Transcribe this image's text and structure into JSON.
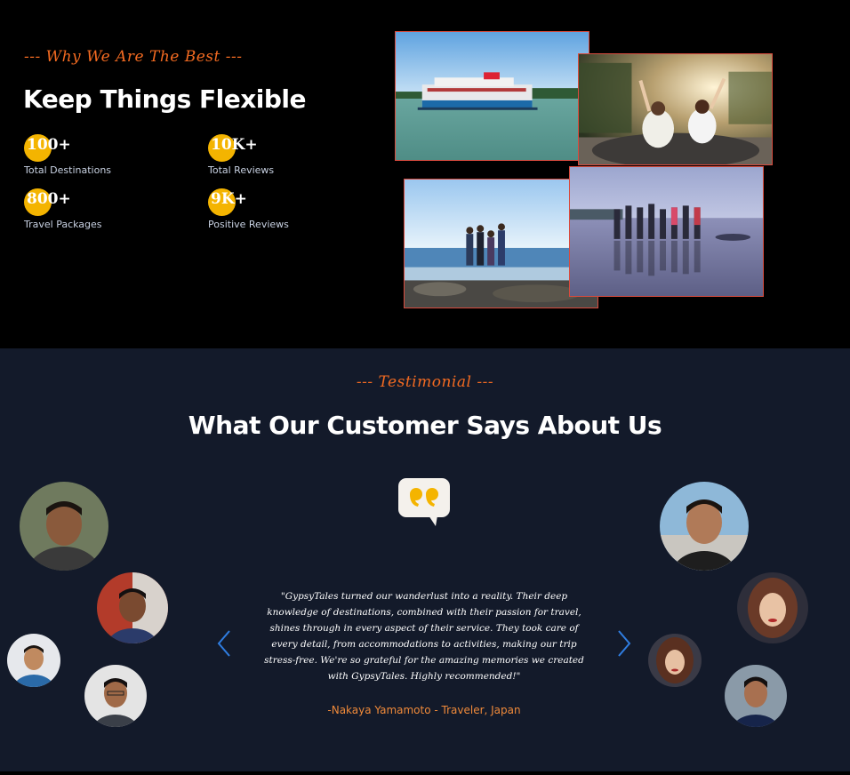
{
  "why": {
    "eyebrow": "--- Why We Are The Best ---",
    "title": "Keep Things Flexible",
    "stats": [
      {
        "value": "100+",
        "label": "Total Destinations"
      },
      {
        "value": "10K+",
        "label": "Total Reviews"
      },
      {
        "value": "800+",
        "label": "Travel Packages"
      },
      {
        "value": "9K+",
        "label": "Positive Reviews"
      }
    ]
  },
  "testimonial": {
    "eyebrow": "--- Testimonial ---",
    "title": "What Our Customer Says About Us",
    "quote": "\"GypsyTales turned our wanderlust into a reality. Their deep knowledge of destinations, combined with their passion for travel, shines through in every aspect of their service. They took care of every detail, from accommodations to activities, making our trip stress-free. We're so grateful for the amazing memories we created with GypsyTales. Highly recommended!\"",
    "author": "-Nakaya Yamamoto - Traveler, Japan"
  },
  "colors": {
    "accent": "#f26a21",
    "stat_dot": "#f4b400",
    "section_bg": "#131a2a",
    "photo_border": "#d84b3e",
    "arrow": "#2f7de1"
  },
  "icons": {
    "prev": "chevron-left-icon",
    "next": "chevron-right-icon",
    "quote": "quote-bubble-icon"
  }
}
